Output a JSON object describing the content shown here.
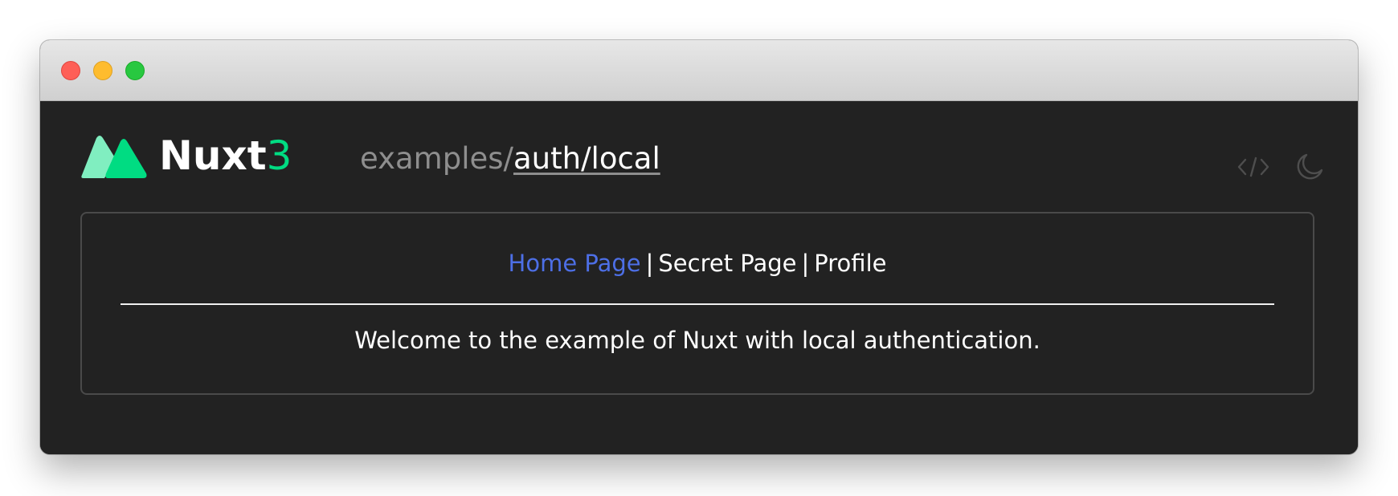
{
  "window": {
    "controls": [
      "close",
      "minimize",
      "zoom"
    ]
  },
  "header": {
    "brand": "Nuxt",
    "brand_number": "3",
    "path_prefix": "examples/",
    "path_link": "auth/local",
    "icons": [
      "nuxt-logo-icon",
      "code-icon",
      "moon-icon"
    ]
  },
  "nav": {
    "items": [
      {
        "label": "Home Page",
        "active": true
      },
      {
        "label": "Secret Page",
        "active": false
      },
      {
        "label": "Profile",
        "active": false
      }
    ],
    "separator": "|"
  },
  "main": {
    "welcome_text": "Welcome to the example of Nuxt with local authentication."
  },
  "colors": {
    "background": "#222222",
    "accent_green": "#00dc82",
    "accent_green_light": "#80eec0",
    "active_link": "#4d6fe6",
    "muted_text": "#8e8e8e"
  }
}
